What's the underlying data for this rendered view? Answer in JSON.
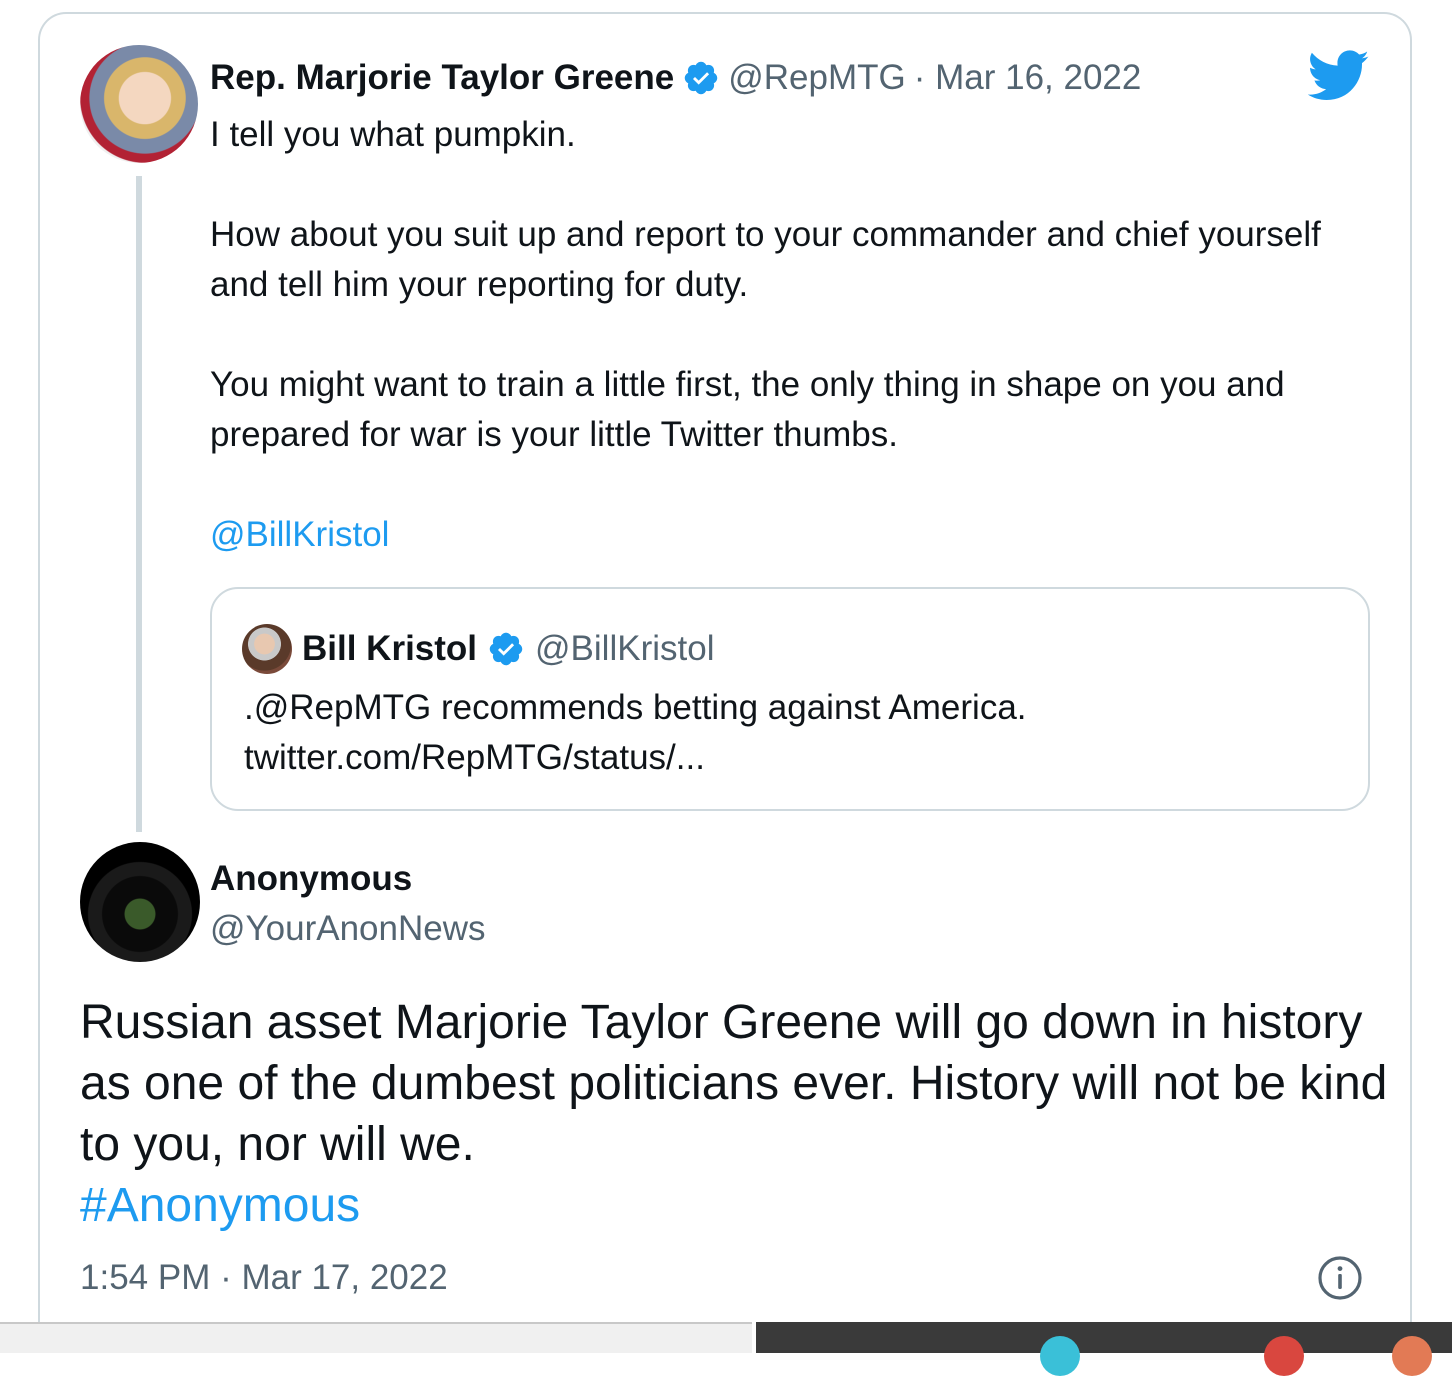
{
  "original_tweet": {
    "author_name": "Rep. Marjorie Taylor Greene",
    "author_handle": "@RepMTG",
    "date": "· Mar 16, 2022",
    "paragraphs": [
      "I tell you what pumpkin.",
      "How about you suit up and report to your commander and chief yourself and tell him your reporting for duty.",
      "You might want to train a little first, the only thing in shape on you and prepared for war is your little Twitter thumbs."
    ],
    "mention": "@BillKristol"
  },
  "quoted_tweet": {
    "author_name": "Bill Kristol",
    "author_handle": "@BillKristol",
    "text_line1": ".@RepMTG recommends betting against America.",
    "text_line2": "twitter.com/RepMTG/status/..."
  },
  "reply_tweet": {
    "author_name": "Anonymous",
    "author_handle": "@YourAnonNews",
    "text": "Russian asset Marjorie Taylor Greene will go down in history as one of the dumbest politicians ever.  History will not be kind to you, nor will we.",
    "hashtag": "#Anonymous",
    "timestamp": "1:54 PM · Mar 17, 2022"
  },
  "colors": {
    "accent": "#1d9bf0",
    "muted": "#536471",
    "border": "#cfd9de",
    "text": "#0f1419"
  },
  "icons": [
    "verified-badge-icon",
    "twitter-bird-icon",
    "info-icon"
  ]
}
